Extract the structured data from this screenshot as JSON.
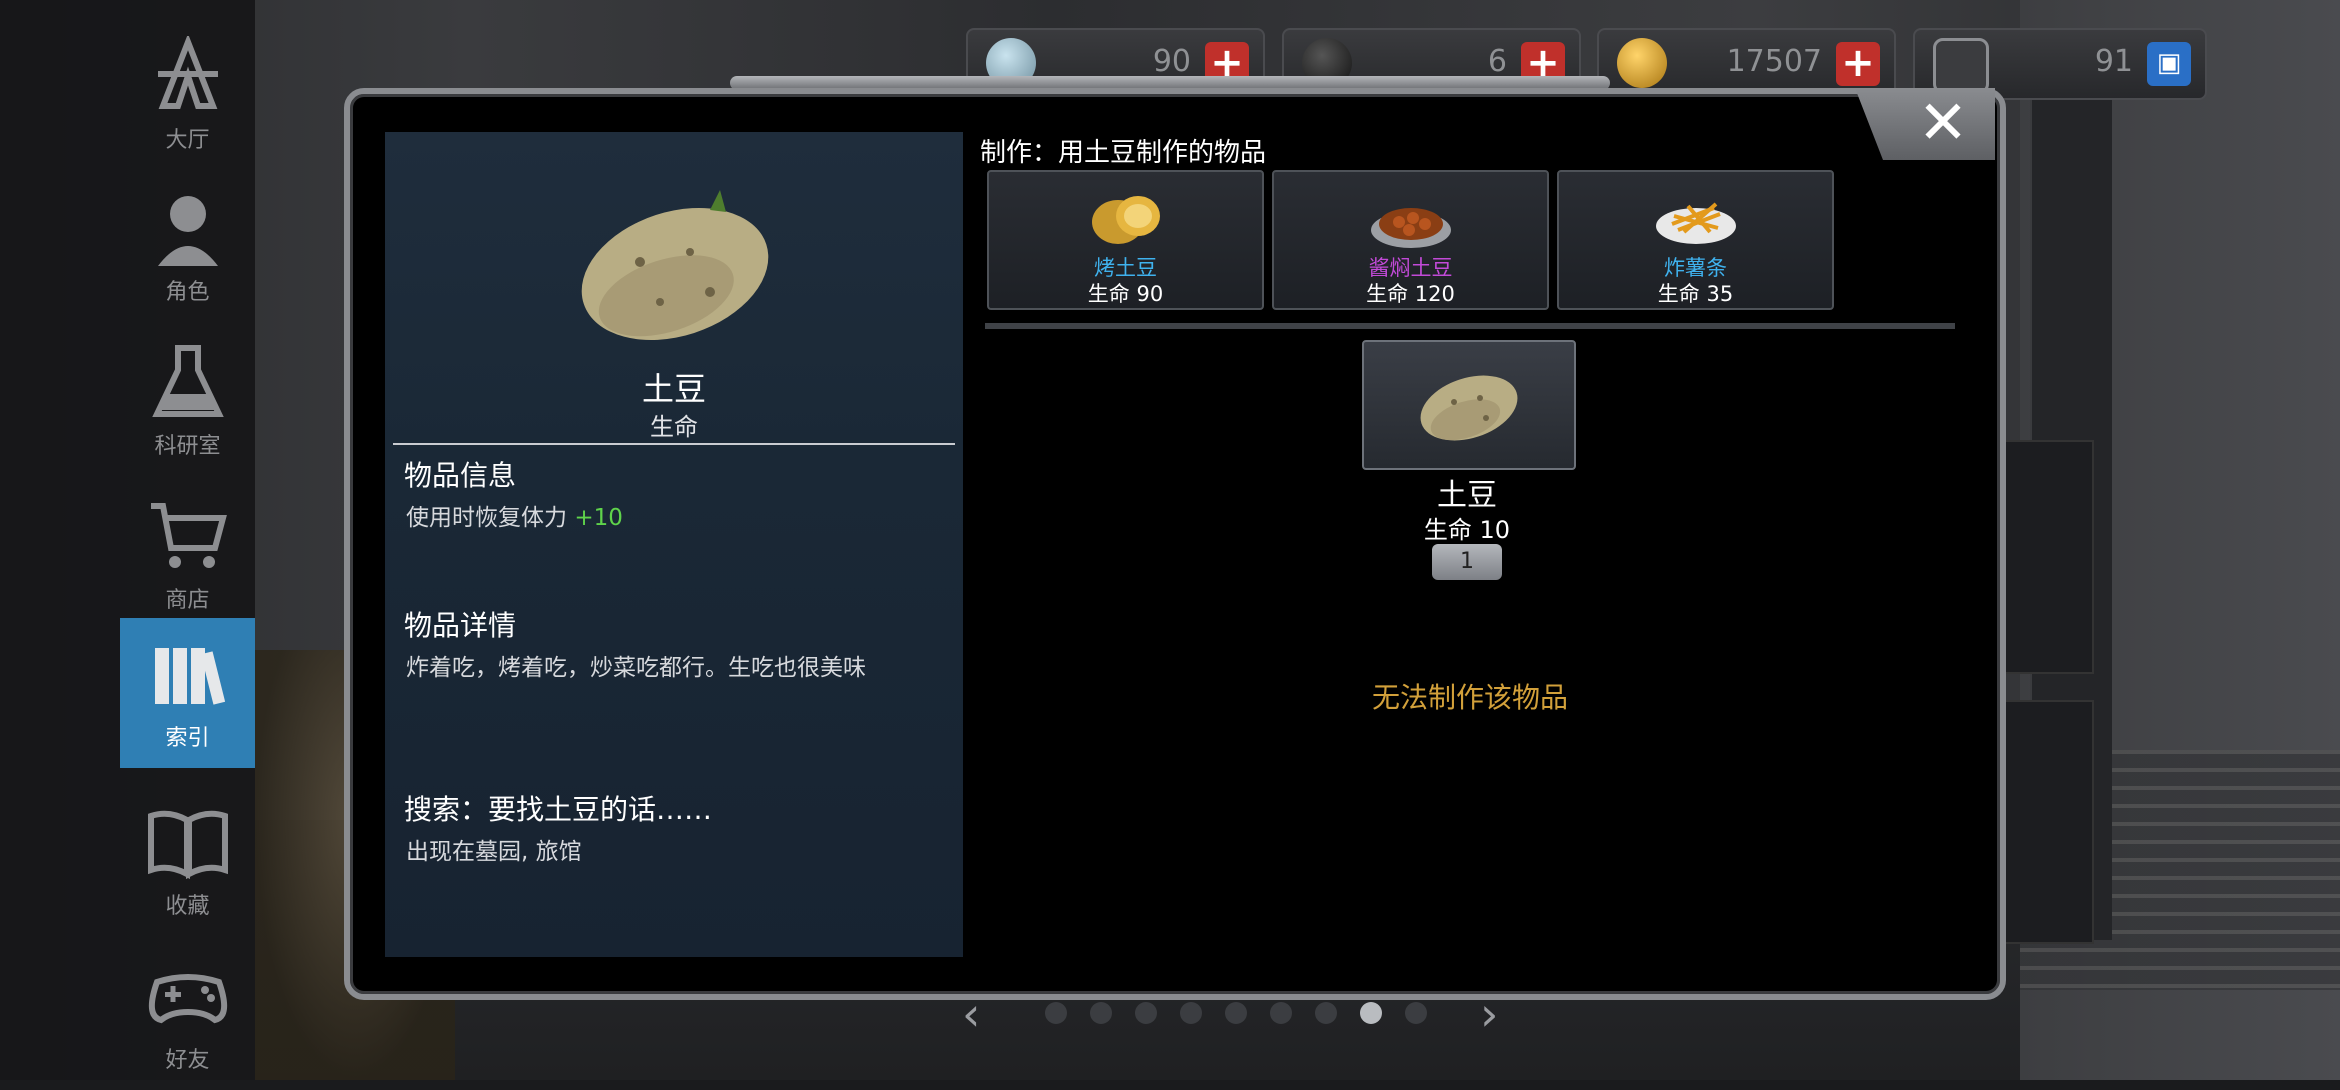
{
  "sidebar": {
    "items": [
      {
        "label": "大厅",
        "icon": "lobby-icon"
      },
      {
        "label": "角色",
        "icon": "character-icon"
      },
      {
        "label": "科研室",
        "icon": "flask-icon"
      },
      {
        "label": "商店",
        "icon": "cart-icon"
      },
      {
        "label": "索引",
        "icon": "books-icon",
        "active": true
      },
      {
        "label": "收藏",
        "icon": "open-book-icon"
      },
      {
        "label": "好友",
        "icon": "gamepad-icon"
      }
    ]
  },
  "currencies": [
    {
      "value": "90",
      "icon": "gem-icon"
    },
    {
      "value": "6",
      "icon": "drive-icon"
    },
    {
      "value": "17507",
      "icon": "gold-coin-icon"
    },
    {
      "value": "91",
      "icon": "bp-icon"
    }
  ],
  "item": {
    "name": "土豆",
    "category": "生命",
    "info_title": "物品信息",
    "info_text": "使用时恢复体力",
    "info_bonus": "+10",
    "detail_title": "物品详情",
    "detail_text": "炸着吃，烤着吃，炒菜吃都行。生吃也很美味",
    "search_title": "搜索：要找土豆的话……",
    "search_text": "出现在墓园, 旅馆"
  },
  "crafting": {
    "heading": "制作：用土豆制作的物品",
    "results": [
      {
        "name": "烤土豆",
        "value": "生命 90",
        "color": "#3fb2ee"
      },
      {
        "name": "酱焖土豆",
        "value": "生命 120",
        "color": "#c24ad8"
      },
      {
        "name": "炸薯条",
        "value": "生命 35",
        "color": "#3fb2ee"
      }
    ],
    "ingredient": {
      "name": "土豆",
      "value": "生命 10",
      "count": "1"
    },
    "status": "无法制作该物品"
  },
  "pager": {
    "prev": "‹",
    "next": "›",
    "total": 9,
    "current": 8
  },
  "close": "✕"
}
